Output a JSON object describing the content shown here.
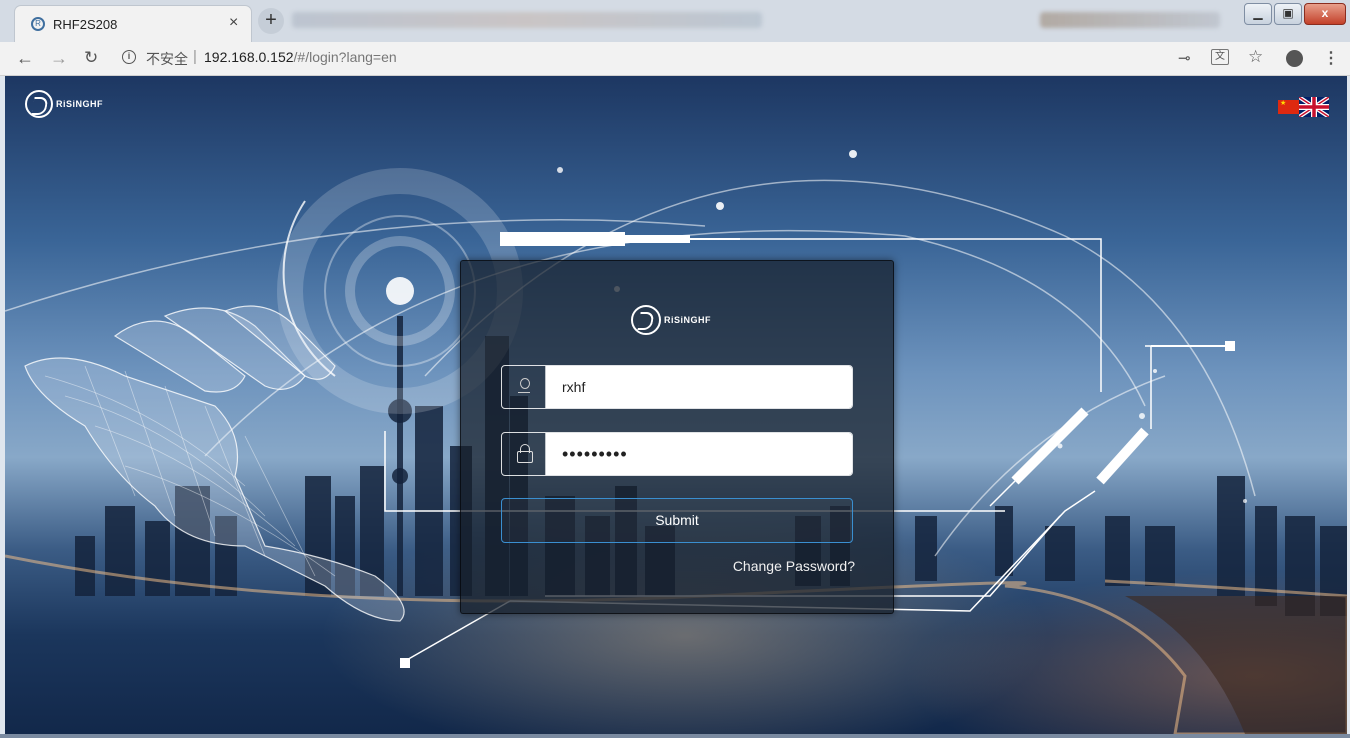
{
  "browser": {
    "tab_title": "RHF2S208",
    "tab_close": "×",
    "new_tab": "+",
    "security_label": "不安全",
    "url_host": "192.168.0.152",
    "url_path": "/#/login?lang=en",
    "window_controls": {
      "minimize": "▁",
      "maximize": "▣",
      "close": "x"
    },
    "icons": [
      "back-icon",
      "forward-icon",
      "reload-icon",
      "info-icon",
      "key-icon",
      "translate-icon",
      "star-icon",
      "account-icon",
      "menu-icon"
    ]
  },
  "page": {
    "logo_text": "RiSiNGHF",
    "languages": [
      "zh-CN",
      "en"
    ],
    "login": {
      "logo_text": "RiSiNGHF",
      "username": "rxhf",
      "password_mask": "•••••••••",
      "submit_label": "Submit",
      "change_password_label": "Change Password?"
    }
  },
  "colors": {
    "submit_border": "#3a8fd0",
    "card_bg": "rgba(22,30,42,0.72)",
    "flag_cn": "#de2910"
  }
}
